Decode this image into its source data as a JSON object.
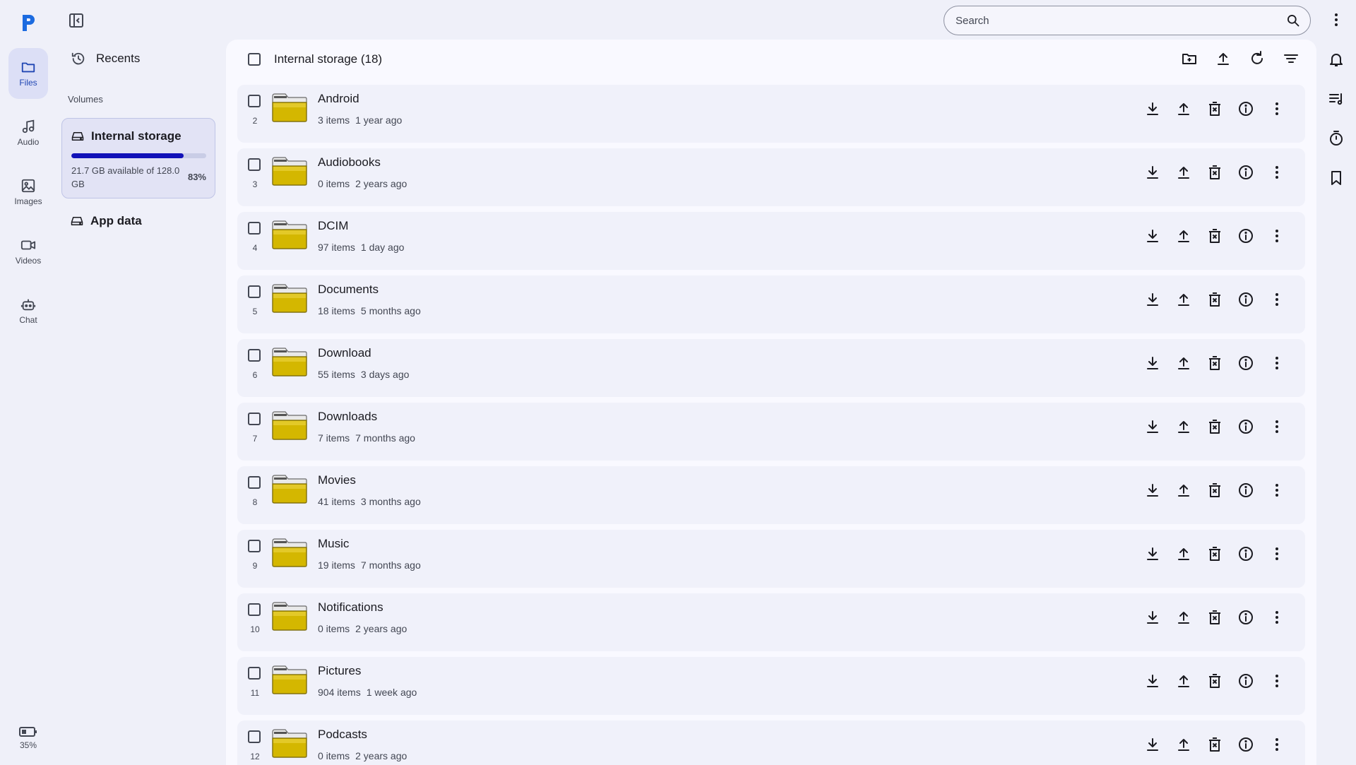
{
  "nav": {
    "items": [
      {
        "label": "Files",
        "icon": "folder-icon",
        "active": true
      },
      {
        "label": "Audio",
        "icon": "music-note-icon"
      },
      {
        "label": "Images",
        "icon": "image-icon"
      },
      {
        "label": "Videos",
        "icon": "video-icon"
      },
      {
        "label": "Chat",
        "icon": "robot-icon"
      }
    ],
    "battery": "35%"
  },
  "sidebar": {
    "recents_label": "Recents",
    "volumes_heading": "Volumes",
    "volume": {
      "name": "Internal storage",
      "info": "21.7 GB available of 128.0 GB",
      "percent": "83%",
      "used_fraction": 0.83
    },
    "app_data_label": "App data"
  },
  "search": {
    "placeholder": "Search"
  },
  "main": {
    "title": "Internal storage (18)",
    "header_actions": [
      "new-folder-icon",
      "upload-icon",
      "refresh-icon",
      "sort-icon"
    ],
    "row_actions": [
      "download-icon",
      "upload-icon",
      "delete-icon",
      "info-icon",
      "more-vert-icon"
    ],
    "rows": [
      {
        "index": "2",
        "name": "Android",
        "items": "3 items",
        "modified": "1 year ago"
      },
      {
        "index": "3",
        "name": "Audiobooks",
        "items": "0 items",
        "modified": "2 years ago"
      },
      {
        "index": "4",
        "name": "DCIM",
        "items": "97 items",
        "modified": "1 day ago"
      },
      {
        "index": "5",
        "name": "Documents",
        "items": "18 items",
        "modified": "5 months ago"
      },
      {
        "index": "6",
        "name": "Download",
        "items": "55 items",
        "modified": "3 days ago"
      },
      {
        "index": "7",
        "name": "Downloads",
        "items": "7 items",
        "modified": "7 months ago"
      },
      {
        "index": "8",
        "name": "Movies",
        "items": "41 items",
        "modified": "3 months ago"
      },
      {
        "index": "9",
        "name": "Music",
        "items": "19 items",
        "modified": "7 months ago"
      },
      {
        "index": "10",
        "name": "Notifications",
        "items": "0 items",
        "modified": "2 years ago"
      },
      {
        "index": "11",
        "name": "Pictures",
        "items": "904 items",
        "modified": "1 week ago"
      },
      {
        "index": "12",
        "name": "Podcasts",
        "items": "0 items",
        "modified": "2 years ago"
      }
    ]
  },
  "right_rail": [
    "notifications-icon",
    "playlist-icon",
    "timer-icon",
    "bookmark-icon"
  ],
  "colors": {
    "accent": "#2046b3",
    "progress": "#1212b8",
    "folder": "#d4b700"
  }
}
